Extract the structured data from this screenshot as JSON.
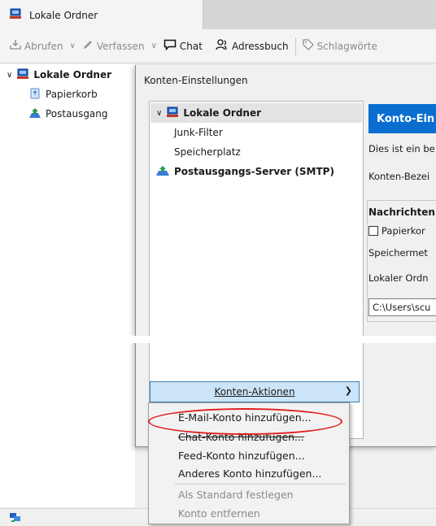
{
  "tab": {
    "title": "Lokale Ordner"
  },
  "toolbar": {
    "fetch": "Abrufen",
    "compose": "Verfassen",
    "chat": "Chat",
    "addressbook": "Adressbuch",
    "tags": "Schlagwörte"
  },
  "folders": {
    "root": "Lokale Ordner",
    "items": [
      "Papierkorb",
      "Postausgang"
    ]
  },
  "dialog": {
    "title": "Konten-Einstellungen",
    "tree": {
      "root": "Lokale Ordner",
      "junk": "Junk-Filter",
      "storage": "Speicherplatz",
      "smtp": "Postausgangs-Server (SMTP)"
    },
    "account_actions": "Konten-Aktionen",
    "right": {
      "banner": "Konto-Ein",
      "desc": "Dies ist ein be",
      "label_name": "Konten-Bezei",
      "group_title": "Nachrichten",
      "checkbox_label": "Papierkor",
      "storage_label": "Speichermet",
      "local_folder": "Lokaler Ordn",
      "path_value": "C:\\Users\\scu"
    }
  },
  "menu": {
    "add_email": "E-Mail-Konto hinzufügen...",
    "add_chat": "Chat-Konto hinzufügen...",
    "add_feed": "Feed-Konto hinzufügen...",
    "add_other": "Anderes Konto hinzufügen...",
    "set_default": "Als Standard festlegen",
    "remove": "Konto entfernen"
  },
  "colors": {
    "accent": "#0a6ed1",
    "highlight_circle": "#e02020",
    "selected_button": "#cce4f7"
  }
}
